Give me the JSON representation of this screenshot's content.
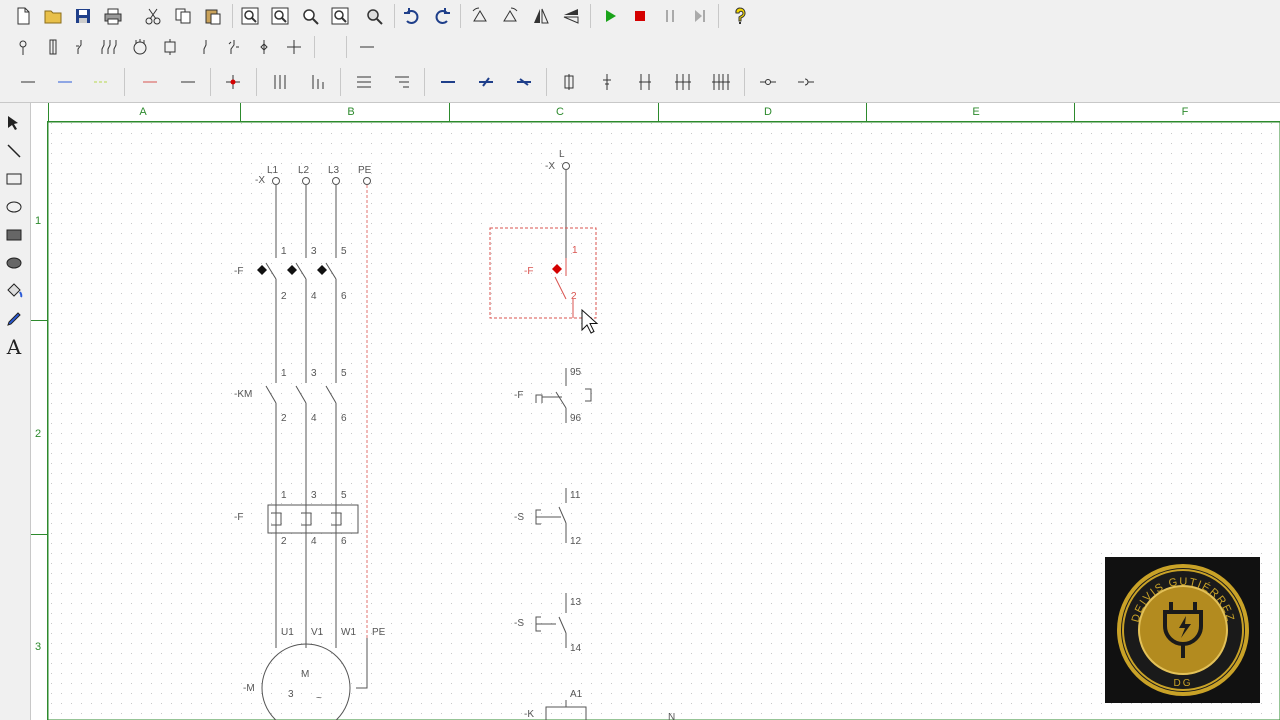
{
  "toolbar1": {
    "icons": [
      "new-file-icon",
      "open-folder-icon",
      "save-icon",
      "print-icon",
      "cut-icon",
      "copy-icon",
      "paste-icon",
      "zoom-in-icon",
      "zoom-out-icon",
      "zoom-window-icon",
      "zoom-fit-icon",
      "zoom-all-icon",
      "undo-icon",
      "redo-icon",
      "rotate-left-icon",
      "rotate-right-icon",
      "mirror-vertical-icon",
      "mirror-horizontal-icon",
      "play-icon",
      "stop-icon",
      "pause-icon",
      "step-icon",
      "help-icon"
    ]
  },
  "toolbar2": {
    "icons": [
      "lamp-icon",
      "fuse-icon",
      "switch-icon",
      "multi-switch-icon",
      "motor-icon",
      "coil-icon",
      "diode-icon",
      "relay-contact-icon",
      "terminal-icon",
      "crossing-icon",
      "wire-icon"
    ]
  },
  "toolbar3": {
    "icons": [
      "wire-black-icon",
      "wire-blue-icon",
      "wire-green-icon",
      "wire-red-icon",
      "wire-dark-icon",
      "junction-icon",
      "bus-3-icon",
      "bus-3-branch-icon",
      "align-left-icon",
      "align-right-icon",
      "line-blue-icon",
      "line-blue-arrow-icon",
      "line-blue-dash-icon",
      "connector-1-icon",
      "connector-2-icon",
      "connector-3-icon",
      "connector-4-icon",
      "connector-5-icon",
      "plug-icon",
      "socket-icon"
    ]
  },
  "leftbar": {
    "icons": [
      "pointer-icon",
      "line-tool-icon",
      "rectangle-tool-icon",
      "ellipse-tool-icon",
      "filled-rectangle-icon",
      "filled-ellipse-icon",
      "fill-bucket-icon",
      "pen-icon",
      "text-tool-icon"
    ],
    "text_tool_label": "A"
  },
  "ruler": {
    "columns": [
      "A",
      "B",
      "C",
      "D",
      "E",
      "F"
    ],
    "rows": [
      "1",
      "2",
      "3"
    ]
  },
  "schematic": {
    "power": {
      "terminal": "-X",
      "phases": [
        "L1",
        "L2",
        "L3",
        "PE"
      ],
      "breaker": {
        "tag": "-F",
        "top": [
          "1",
          "3",
          "5"
        ],
        "bottom": [
          "2",
          "4",
          "6"
        ]
      },
      "contactor": {
        "tag": "-KM",
        "top": [
          "1",
          "3",
          "5"
        ],
        "bottom": [
          "2",
          "4",
          "6"
        ]
      },
      "overload": {
        "tag": "-F",
        "top": [
          "1",
          "3",
          "5"
        ],
        "bottom": [
          "2",
          "4",
          "6"
        ]
      },
      "motor_terminals": [
        "U1",
        "V1",
        "W1",
        "PE"
      ],
      "motor": {
        "tag": "-M",
        "letter": "M",
        "phase": "3",
        "symbol": "~"
      }
    },
    "control": {
      "terminal": {
        "tag": "-X",
        "label": "L"
      },
      "breaker": {
        "tag": "-F",
        "top": "1",
        "bottom": "2"
      },
      "overload_contact": {
        "tag": "-F",
        "top": "95",
        "bottom": "96"
      },
      "stop_button": {
        "tag": "-S",
        "top": "11",
        "bottom": "12"
      },
      "start_button": {
        "tag": "-S",
        "top": "13",
        "bottom": "14"
      },
      "coil": {
        "tag": "-K",
        "top": "A1"
      },
      "neutral": "N"
    }
  },
  "colors": {
    "ruler": "#2d8a2d",
    "selection": "#d9534f",
    "wire": "#555555",
    "logo_gold": "#c9a227"
  },
  "logo": {
    "name": "DEIVIS GUTIÉRREZ",
    "initials": "DG"
  }
}
